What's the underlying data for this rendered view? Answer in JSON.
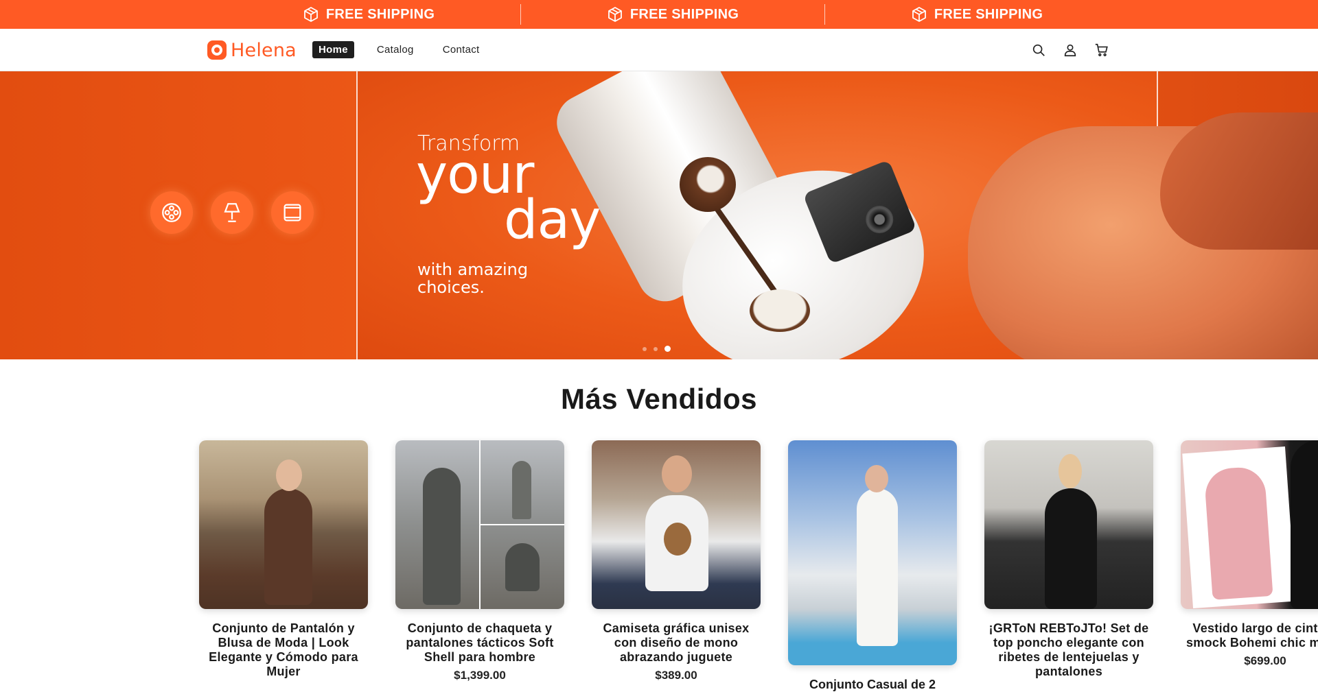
{
  "announcement": {
    "items": [
      "FREE SHIPPING",
      "FREE SHIPPING",
      "FREE SHIPPING"
    ],
    "icon": "box-icon"
  },
  "header": {
    "logo_text": "Helena",
    "nav": [
      {
        "label": "Home",
        "active": true
      },
      {
        "label": "Catalog",
        "active": false
      },
      {
        "label": "Contact",
        "active": false
      }
    ],
    "icons": [
      "search-icon",
      "account-icon",
      "cart-icon"
    ]
  },
  "hero": {
    "line1": "Transform",
    "line2a": "your",
    "line2b": "day",
    "line3": "with amazing choices.",
    "feature_icons": [
      "film-reel-icon",
      "lamp-icon",
      "frame-icon"
    ],
    "slides": 3,
    "active_slide": 3
  },
  "bestsellers": {
    "title": "Más Vendidos",
    "products": [
      {
        "title": "Conjunto de Pantalón y Blusa de Moda | Look Elegante y Cómodo para Mujer",
        "price": ""
      },
      {
        "title": "Conjunto de chaqueta y pantalones tácticos Soft Shell para hombre",
        "price": "$1,399.00"
      },
      {
        "title": "Camiseta gráfica unisex con diseño de mono abrazando juguete",
        "price": "$389.00"
      },
      {
        "title": "Conjunto Casual de 2",
        "price": ""
      },
      {
        "title": "¡GRToN REBToJTo!   Set de top poncho elegante con ribetes de lentejuelas y pantalones",
        "price": ""
      },
      {
        "title": "Vestido largo de cintura smock Bohemi chic mujer",
        "price": "$699.00"
      }
    ]
  },
  "colors": {
    "accent": "#ff5a24",
    "dark": "#1f1f1f"
  }
}
